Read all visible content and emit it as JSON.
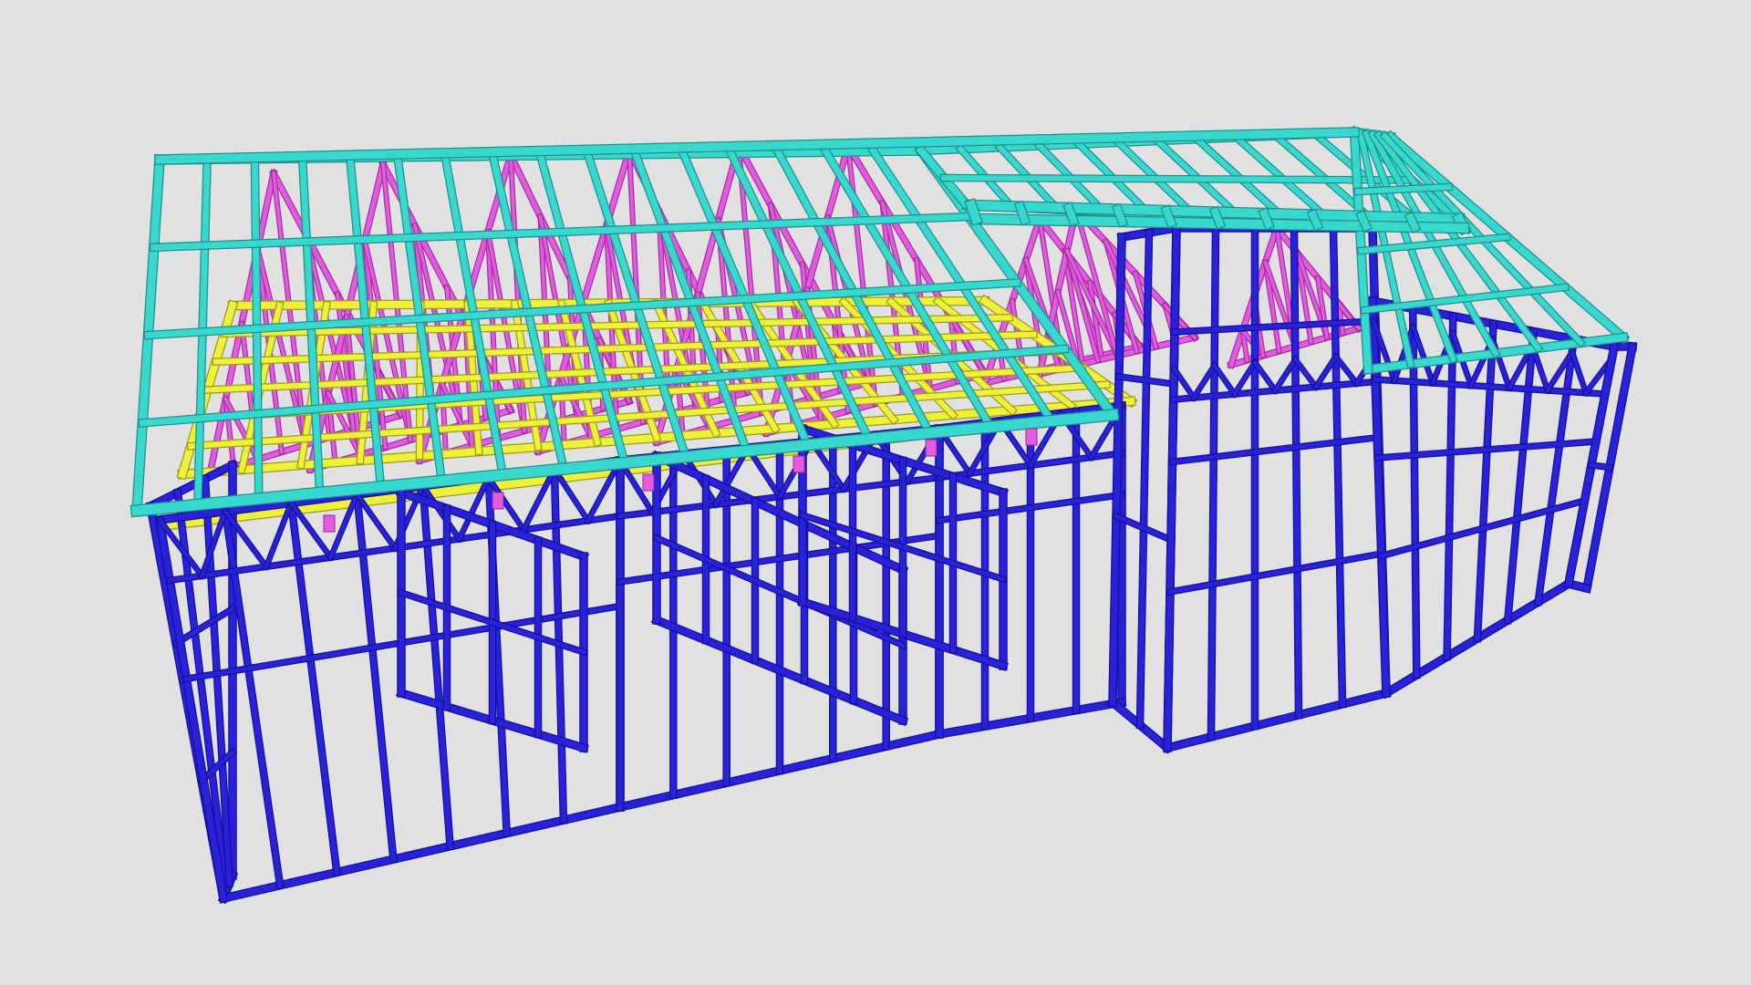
{
  "scene": {
    "background": "#e1e1e1",
    "colors": {
      "wall_frame": "#2a22d8",
      "wall_frame_dark": "#14109a",
      "roof_frame": "#38d8cf",
      "roof_frame_dark": "#1f8f8a",
      "ceiling_joists": "#eef03a",
      "roof_trusses": "#e25be0"
    },
    "components": [
      "wall-frames",
      "roof-frame",
      "ceiling-joists",
      "roof-trusses"
    ]
  }
}
